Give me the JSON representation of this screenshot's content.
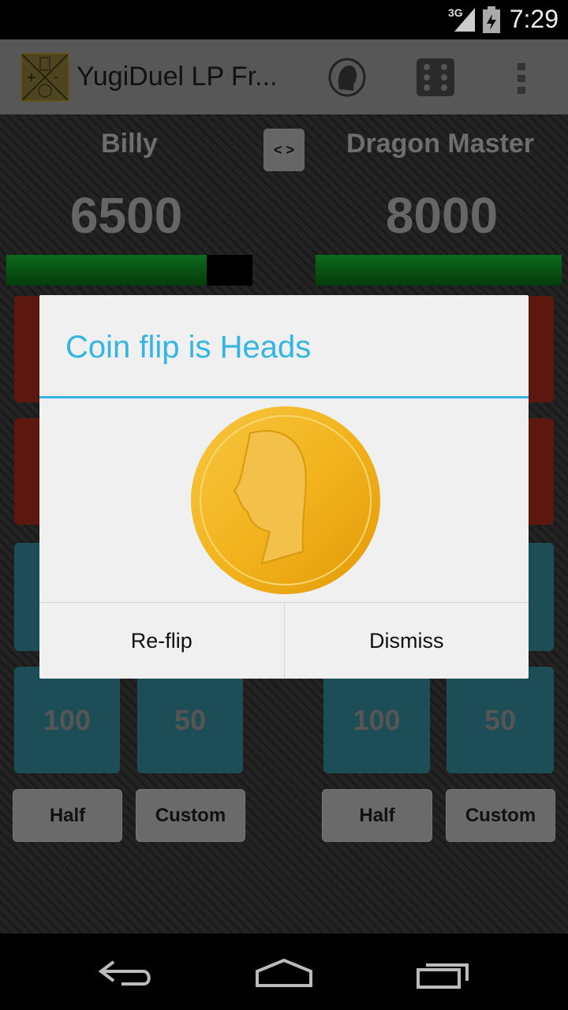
{
  "status_bar": {
    "network": "3G",
    "time": "7:29"
  },
  "app_bar": {
    "title": "YugiDuel LP Fr...",
    "icons": [
      "app-logo",
      "profile-head-icon",
      "dice-icon",
      "overflow-menu-icon"
    ]
  },
  "players": [
    {
      "name": "Billy",
      "life_points": "6500",
      "lp_fraction": 0.8125
    },
    {
      "name": "Dragon Master",
      "life_points": "8000",
      "lp_fraction": 1.0
    }
  ],
  "swap_label": "< >",
  "buttons": {
    "hundred": "100",
    "fifty": "50",
    "half": "Half",
    "custom": "Custom"
  },
  "dialog": {
    "title": "Coin flip is Heads",
    "image": "coin-heads",
    "reflip": "Re-flip",
    "dismiss": "Dismiss"
  },
  "colors": {
    "accent": "#33b5e5",
    "lp_bar": "#0c6a1a",
    "coin": "#f2b01e"
  }
}
